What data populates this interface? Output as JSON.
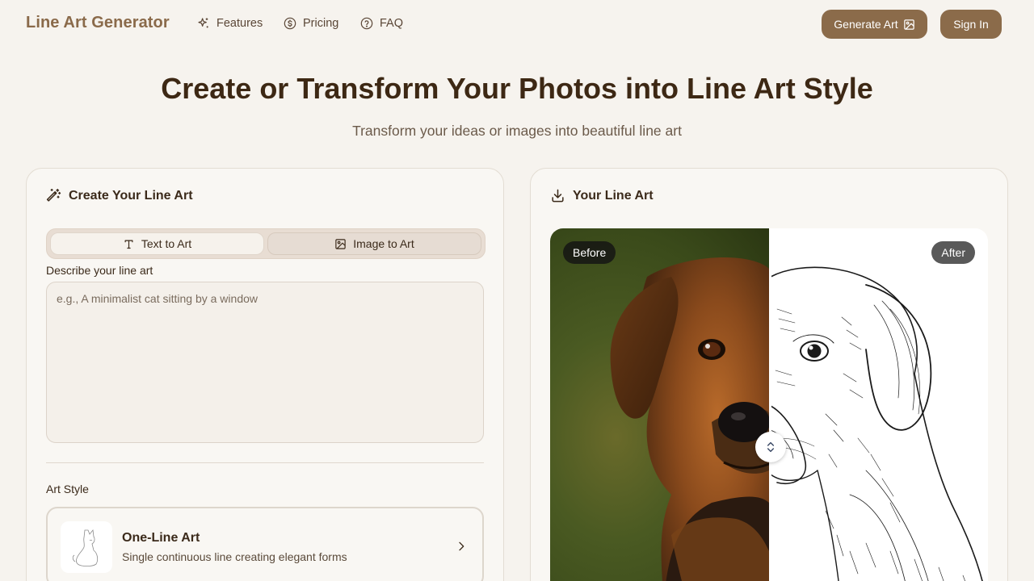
{
  "nav": {
    "brand": "Line Art Generator",
    "links": [
      {
        "label": "Features",
        "icon": "sparkles-icon"
      },
      {
        "label": "Pricing",
        "icon": "dollar-circle-icon"
      },
      {
        "label": "FAQ",
        "icon": "help-circle-icon"
      }
    ],
    "generate_label": "Generate Art",
    "signin_label": "Sign In"
  },
  "hero": {
    "title": "Create or Transform Your Photos into Line Art Style",
    "subtitle": "Transform your ideas or images into beautiful line art"
  },
  "create_panel": {
    "title": "Create Your Line Art",
    "tabs": [
      {
        "label": "Text to Art",
        "active": true
      },
      {
        "label": "Image to Art",
        "active": false
      }
    ],
    "describe_label": "Describe your line art",
    "prompt_placeholder": "e.g., A minimalist cat sitting by a window",
    "prompt_value": "",
    "art_style_label": "Art Style",
    "style": {
      "name": "One-Line Art",
      "description": "Single continuous line creating elegant forms"
    }
  },
  "result_panel": {
    "title": "Your Line Art",
    "before_label": "Before",
    "after_label": "After",
    "split_fraction": 0.5
  },
  "colors": {
    "accent": "#8b6b4a",
    "background": "#f6f3ee",
    "heading": "#3d2814"
  }
}
